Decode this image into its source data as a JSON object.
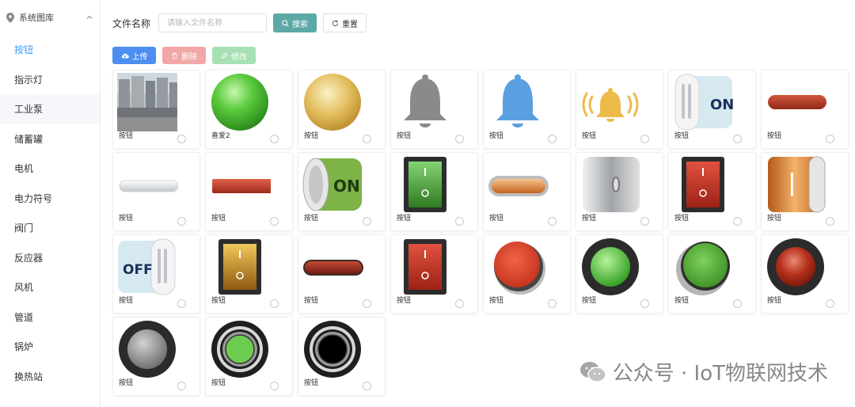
{
  "sidebar": {
    "header": "系统图库",
    "items": [
      {
        "label": "按钮",
        "active": true
      },
      {
        "label": "指示灯"
      },
      {
        "label": "工业泵"
      },
      {
        "label": "储蓄罐"
      },
      {
        "label": "电机"
      },
      {
        "label": "电力符号"
      },
      {
        "label": "阀门"
      },
      {
        "label": "反应器"
      },
      {
        "label": "风机"
      },
      {
        "label": "管道"
      },
      {
        "label": "锅炉"
      },
      {
        "label": "换热站"
      }
    ]
  },
  "search": {
    "label": "文件名称",
    "placeholder": "请输入文件名称",
    "search_button": "搜索",
    "reset_button": "重置"
  },
  "actions": {
    "upload": "上传",
    "delete": "删除",
    "edit": "修改"
  },
  "gallery": [
    {
      "label": "按钮",
      "icon": "building-photo"
    },
    {
      "label": "喜爱2",
      "icon": "green-sphere"
    },
    {
      "label": "按钮",
      "icon": "gold-sphere"
    },
    {
      "label": "按钮",
      "icon": "gray-bell"
    },
    {
      "label": "按钮",
      "icon": "blue-bell"
    },
    {
      "label": "按钮",
      "icon": "ringing-bell"
    },
    {
      "label": "按钮",
      "icon": "on-toggle-white"
    },
    {
      "label": "按钮",
      "icon": "red-pill"
    },
    {
      "label": "按钮",
      "icon": "white-pill"
    },
    {
      "label": "按钮",
      "icon": "red-bar"
    },
    {
      "label": "按钮",
      "icon": "on-toggle-green"
    },
    {
      "label": "按钮",
      "icon": "green-rocker"
    },
    {
      "label": "按钮",
      "icon": "orange-pill"
    },
    {
      "label": "按钮",
      "icon": "silver-toggle"
    },
    {
      "label": "按钮",
      "icon": "red-rocker"
    },
    {
      "label": "按钮",
      "icon": "orange-toggle"
    },
    {
      "label": "按钮",
      "icon": "off-toggle"
    },
    {
      "label": "按钮",
      "icon": "yellow-rocker"
    },
    {
      "label": "按钮",
      "icon": "dark-red-pill"
    },
    {
      "label": "按钮",
      "icon": "red-rocker-2"
    },
    {
      "label": "按钮",
      "icon": "red-push-button"
    },
    {
      "label": "按钮",
      "icon": "green-ring-button"
    },
    {
      "label": "按钮",
      "icon": "green-push-button"
    },
    {
      "label": "按钮",
      "icon": "red-ring-button"
    },
    {
      "label": "按钮",
      "icon": "gray-ring-button"
    },
    {
      "label": "按钮",
      "icon": "green-metal-button"
    },
    {
      "label": "按钮",
      "icon": "black-metal-button"
    }
  ],
  "watermark": "公众号 · IoT物联网技术",
  "colors": {
    "accent": "#409eff",
    "search_button": "#5ca8a5",
    "upload_button": "#4c8ff0",
    "delete_button": "#f2a7a7",
    "edit_button": "#a7e0b5"
  }
}
